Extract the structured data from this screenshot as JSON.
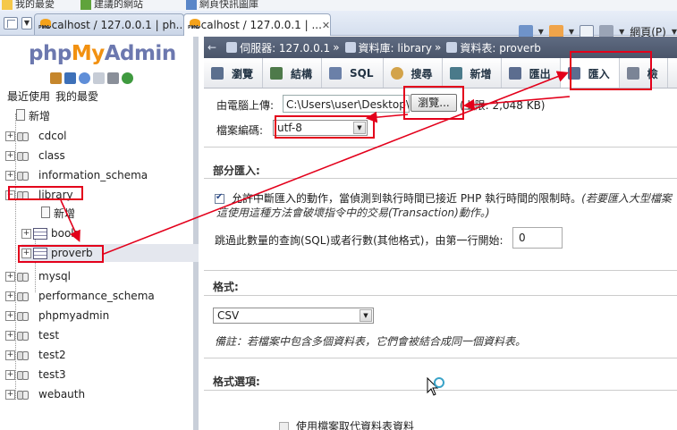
{
  "browser": {
    "favorites": [
      "我的最愛",
      "建議的網站",
      "網頁快訊圖庫"
    ],
    "tabs": [
      {
        "title": "localhost / 127.0.0.1 | ph..."
      },
      {
        "title": "localhost / 127.0.0.1 | ...",
        "close": "✕"
      }
    ],
    "tools": {
      "page_label": "網頁(P)"
    }
  },
  "nav": {
    "logo": {
      "php": "php",
      "my": "My",
      "admin": "Admin"
    },
    "tabs": [
      "最近使用",
      "我的最愛"
    ],
    "tree": [
      {
        "label": "新增",
        "type": "new"
      },
      {
        "label": "cdcol",
        "type": "db"
      },
      {
        "label": "class",
        "type": "db"
      },
      {
        "label": "information_schema",
        "type": "db"
      },
      {
        "label": "library",
        "type": "db"
      },
      {
        "label": "新增",
        "type": "new-child"
      },
      {
        "label": "book",
        "type": "table"
      },
      {
        "label": "proverb",
        "type": "table"
      },
      {
        "label": "mysql",
        "type": "db"
      },
      {
        "label": "performance_schema",
        "type": "db"
      },
      {
        "label": "phpmyadmin",
        "type": "db"
      },
      {
        "label": "test",
        "type": "db"
      },
      {
        "label": "test2",
        "type": "db"
      },
      {
        "label": "test3",
        "type": "db"
      },
      {
        "label": "webauth",
        "type": "db"
      }
    ]
  },
  "breadcrumb": {
    "back": "←",
    "server": "伺服器: 127.0.0.1",
    "database": "資料庫: library",
    "table": "資料表: proverb"
  },
  "menu": {
    "tabs": [
      "瀏覽",
      "結構",
      "SQL",
      "搜尋",
      "新增",
      "匯出",
      "匯入",
      "檢"
    ]
  },
  "upload": {
    "label": "由電腦上傳:",
    "file_value": "C:\\Users\\user\\Desktop\\成",
    "browse_label": "瀏覽...",
    "limit": "(上限: 2,048 KB)"
  },
  "encoding": {
    "label": "檔案編碼:",
    "value": "utf-8"
  },
  "partial": {
    "title": "部分匯入:",
    "allow_interrupt": "允許中斷匯入的動作，當偵測到執行時間已接近 PHP 執行時間的限制時。",
    "allow_note_1": "(若要匯入大型檔案",
    "allow_note_2": "這使用這種方法會破壞指令中的交易(Transaction)動作。)",
    "skip_label": "跳過此數量的查詢(SQL)或者行數(其他格式)，由第一行開始:",
    "skip_value": "0"
  },
  "format": {
    "title": "格式:",
    "value": "CSV",
    "note": "備註：若檔案中包含多個資料表，它們會被結合成同一個資料表。"
  },
  "format_options": {
    "title": "格式選項:",
    "replace_label": "使用檔案取代資料表資料"
  },
  "colors": {
    "annotation": "#e3001b",
    "crumb_bg": "#4a556a",
    "logo_blue": "#6c78af",
    "logo_orange": "#f29111"
  }
}
